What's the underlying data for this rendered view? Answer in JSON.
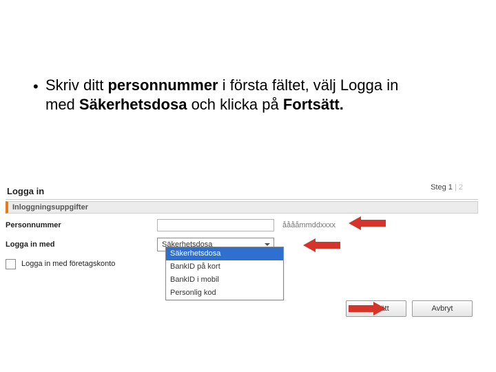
{
  "instruction": {
    "pre": "Skriv ditt ",
    "b1": "personnummer",
    "mid1": " i första fältet, välj Logga in med ",
    "b2": "Säkerhetsdosa",
    "mid2": " och klicka på ",
    "b3": "Fortsätt.",
    "bullet": "•"
  },
  "panel": {
    "header": "Logga in",
    "step_label": "Steg",
    "step_current": "1",
    "step_total": "2",
    "section_title": "Inloggningsuppgifter",
    "pn_label": "Personnummer",
    "pn_hint": "ååååmmddxxxx",
    "login_with_label": "Logga in med",
    "select_value": "Säkerhetsdosa",
    "options": {
      "o0": "Säkerhetsdosa",
      "o1": "BankID på kort",
      "o2": "BankID i mobil",
      "o3": "Personlig kod"
    },
    "corp_label": "Logga in med företagskonto",
    "btn_continue": "Fortsätt",
    "btn_cancel": "Avbryt"
  },
  "colors": {
    "arrow": "#d4342a",
    "accent": "#e87a1a",
    "highlight": "#2f6fd0"
  }
}
